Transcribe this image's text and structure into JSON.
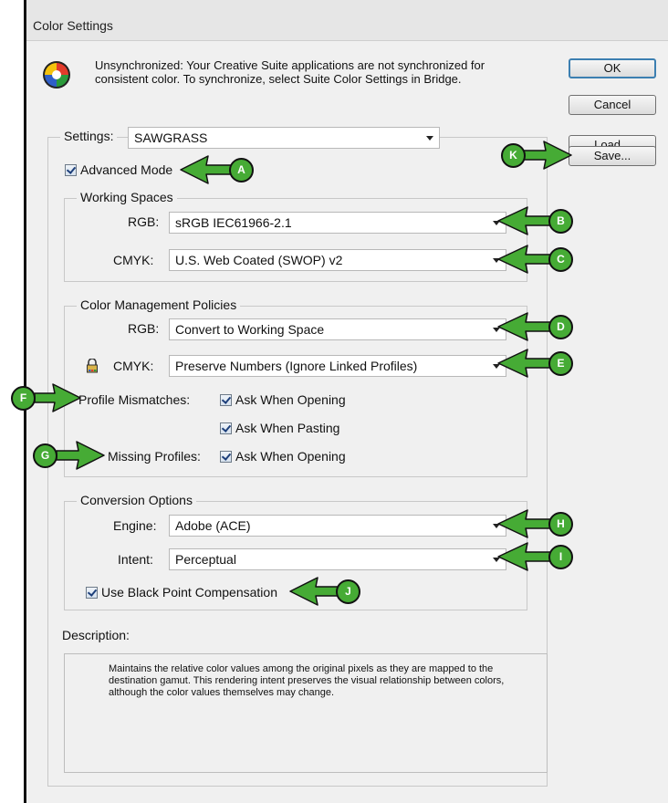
{
  "window": {
    "title": "Color Settings"
  },
  "sync_message": "Unsynchronized: Your Creative Suite applications are not synchronized for consistent color. To synchronize, select Suite Color Settings in Bridge.",
  "buttons": {
    "ok": "OK",
    "cancel": "Cancel",
    "load": "Load...",
    "save": "Save..."
  },
  "settings": {
    "label": "Settings:",
    "value": "SAWGRASS"
  },
  "advanced_mode": {
    "label": "Advanced Mode",
    "checked": true
  },
  "working_spaces": {
    "legend": "Working Spaces",
    "rgb_label": "RGB:",
    "rgb_value": "sRGB IEC61966-2.1",
    "cmyk_label": "CMYK:",
    "cmyk_value": "U.S. Web Coated (SWOP) v2"
  },
  "policies": {
    "legend": "Color Management Policies",
    "rgb_label": "RGB:",
    "rgb_value": "Convert to Working Space",
    "cmyk_label": "CMYK:",
    "cmyk_value": "Preserve Numbers (Ignore Linked Profiles)",
    "mismatch_label": "Profile Mismatches:",
    "ask_opening": "Ask When Opening",
    "ask_pasting": "Ask When Pasting",
    "missing_label": "Missing Profiles:",
    "missing_ask_opening": "Ask When Opening"
  },
  "conversion": {
    "legend": "Conversion Options",
    "engine_label": "Engine:",
    "engine_value": "Adobe (ACE)",
    "intent_label": "Intent:",
    "intent_value": "Perceptual",
    "bpc_label": "Use Black Point Compensation"
  },
  "description": {
    "label": "Description:",
    "text": "Maintains the relative color values among the original pixels as they are mapped to the destination gamut. This rendering intent preserves the visual relationship between colors, although the color values themselves may change."
  },
  "callouts": {
    "a": "A",
    "b": "B",
    "c": "C",
    "d": "D",
    "e": "E",
    "f": "F",
    "g": "G",
    "h": "H",
    "i": "I",
    "j": "J",
    "k": "K"
  },
  "colors": {
    "callout_green": "#46ab35",
    "dialog_bg": "#f0f0f0"
  }
}
